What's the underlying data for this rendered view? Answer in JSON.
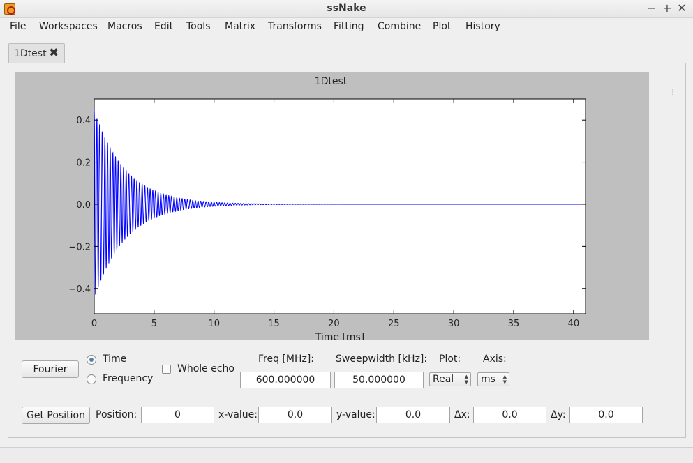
{
  "window": {
    "title": "ssNake"
  },
  "window_controls": {
    "minimize": "−",
    "maximize": "+",
    "close": "✕"
  },
  "menu": [
    "File",
    "Workspaces",
    "Macros",
    "Edit",
    "Tools",
    "Matrix",
    "Transforms",
    "Fitting",
    "Combine",
    "Plot",
    "History"
  ],
  "tabs": [
    {
      "label": "1Dtest",
      "close": "✖"
    }
  ],
  "chart_data": {
    "type": "line",
    "title": "1Dtest",
    "xlabel": "Time [ms]",
    "ylabel": "",
    "xlim": [
      0,
      41
    ],
    "ylim": [
      -0.52,
      0.5
    ],
    "xticks": [
      0,
      5,
      10,
      15,
      20,
      25,
      30,
      35,
      40
    ],
    "yticks": [
      0.4,
      0.2,
      0.0,
      -0.2,
      -0.4
    ],
    "ytick_labels": [
      "0.4",
      "0.2",
      "0.0",
      "−0.2",
      "−0.4"
    ],
    "grid": false,
    "series": [
      {
        "color": "#0000ff",
        "description": "decaying oscillating signal (FID)",
        "initial_amplitude": 0.45,
        "decay_time_ms": 2.6,
        "oscillation_frequency_khz": 4.5
      }
    ]
  },
  "controls": {
    "fourier_button": "Fourier",
    "domain_options": [
      "Time",
      "Frequency"
    ],
    "domain_selected": "Time",
    "whole_echo_label": "Whole echo",
    "whole_echo_checked": false,
    "freq_label": "Freq [MHz]:",
    "freq_value": "600.000000",
    "sweepwidth_label": "Sweepwidth [kHz]:",
    "sweepwidth_value": "50.000000",
    "plot_label": "Plot:",
    "plot_value": "Real",
    "axis_label": "Axis:",
    "axis_value": "ms"
  },
  "position_bar": {
    "get_position_button": "Get Position",
    "position_label": "Position:",
    "position_value": "0",
    "xvalue_label": "x-value:",
    "xvalue_value": "0.0",
    "yvalue_label": "y-value:",
    "yvalue_value": "0.0",
    "dx_label": "Δx:",
    "dx_value": "0.0",
    "dy_label": "Δy:",
    "dy_value": "0.0"
  }
}
